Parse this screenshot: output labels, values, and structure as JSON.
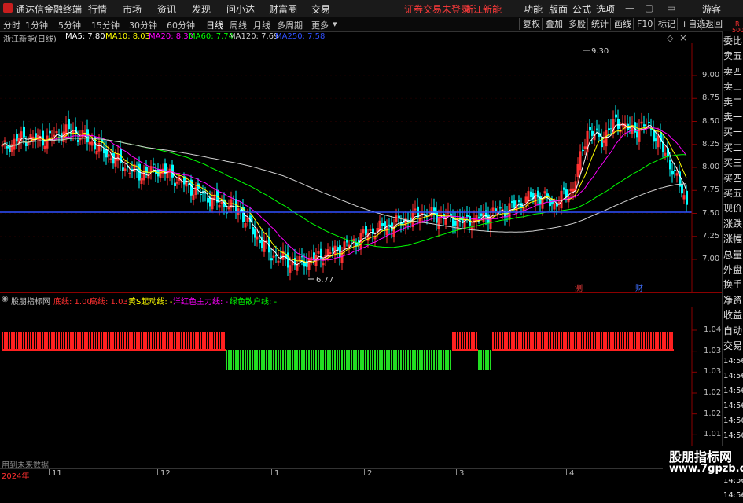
{
  "app": {
    "name": "通达信金融终端"
  },
  "menu": {
    "items": [
      "行情",
      "市场",
      "资讯",
      "发现",
      "问小达",
      "财富圈",
      "交易"
    ],
    "warning": "证券交易未登录",
    "stock": "浙江新能",
    "right": [
      "功能",
      "版面",
      "公式",
      "选项"
    ],
    "guest": "游客"
  },
  "toolbar": {
    "timeframes": [
      "分时",
      "1分钟",
      "5分钟",
      "15分钟",
      "30分钟",
      "60分钟",
      "日线",
      "周线",
      "月线",
      "多周期",
      "更多"
    ],
    "active": "日线",
    "buttons": [
      "复权",
      "叠加",
      "多股",
      "统计",
      "画线",
      "F10",
      "标记",
      "+自选",
      "返回"
    ]
  },
  "legend": {
    "title": "浙江新能(日线)",
    "ma": [
      {
        "label": "MA5: 7.80",
        "color": "#ffffff"
      },
      {
        "label": "MA10: 8.03",
        "color": "#ffff00"
      },
      {
        "label": "MA20: 8.30",
        "color": "#ff00ff"
      },
      {
        "label": "MA60: 7.74",
        "color": "#00ff00"
      },
      {
        "label": "MA120: 7.69",
        "color": "#d0d0d0"
      },
      {
        "label": "MA250: 7.58",
        "color": "#3050ff"
      }
    ]
  },
  "yaxis": {
    "main": [
      "9.00",
      "8.75",
      "8.50",
      "8.25",
      "8.00",
      "7.75",
      "7.50",
      "7.25",
      "7.00"
    ],
    "ind": [
      "1.04",
      "1.03",
      "1.03",
      "1.02",
      "1.02",
      "1.01",
      "1.01"
    ]
  },
  "annotations": {
    "high": "9.30",
    "low": "6.77",
    "tag1": "测",
    "tag2": "财"
  },
  "indicator": {
    "title": "股朋指标网",
    "items": [
      {
        "label": "底线: 1.00",
        "color": "#ff3030"
      },
      {
        "label": "高线: 1.03",
        "color": "#ff3030"
      },
      {
        "label": "黄S起动线: -",
        "color": "#ffff00"
      },
      {
        "label": "洋红色主力线: -",
        "color": "#ff00ff"
      },
      {
        "label": "绿色散户线: -",
        "color": "#00ff00"
      }
    ]
  },
  "sidebar": {
    "top": "R",
    "top2": "500",
    "items": [
      "委比",
      "卖五",
      "卖四",
      "卖三",
      "卖二",
      "卖一",
      "买一",
      "买二",
      "买三",
      "买四",
      "买五",
      "现价",
      "涨跌",
      "涨幅",
      "总量",
      "外盘",
      "换手",
      "净资",
      "收益"
    ],
    "lower": [
      "自动",
      "交易"
    ],
    "times": [
      "14:56",
      "14:56",
      "14:56",
      "14:56",
      "14:56",
      "14:56",
      "14:56",
      "14:56",
      "14:56",
      "14:56"
    ]
  },
  "footer": {
    "status": "用到未来数据",
    "xlabels": [
      "2024年",
      "11",
      "12",
      "1",
      "2",
      "3",
      "4"
    ]
  },
  "watermark": {
    "title": "股朋指标网",
    "url": "www.7gpzb.com"
  },
  "colors": {
    "up": "#ff3232",
    "down": "#00ffff",
    "ind_red": "#ff2020",
    "ind_green": "#22dd22"
  }
}
